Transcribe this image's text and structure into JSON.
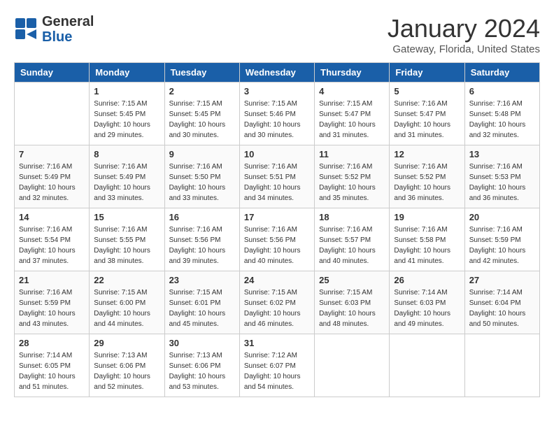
{
  "header": {
    "logo_general": "General",
    "logo_blue": "Blue",
    "title": "January 2024",
    "subtitle": "Gateway, Florida, United States"
  },
  "weekdays": [
    "Sunday",
    "Monday",
    "Tuesday",
    "Wednesday",
    "Thursday",
    "Friday",
    "Saturday"
  ],
  "weeks": [
    [
      {
        "day": "",
        "info": ""
      },
      {
        "day": "1",
        "info": "Sunrise: 7:15 AM\nSunset: 5:45 PM\nDaylight: 10 hours\nand 29 minutes."
      },
      {
        "day": "2",
        "info": "Sunrise: 7:15 AM\nSunset: 5:45 PM\nDaylight: 10 hours\nand 30 minutes."
      },
      {
        "day": "3",
        "info": "Sunrise: 7:15 AM\nSunset: 5:46 PM\nDaylight: 10 hours\nand 30 minutes."
      },
      {
        "day": "4",
        "info": "Sunrise: 7:15 AM\nSunset: 5:47 PM\nDaylight: 10 hours\nand 31 minutes."
      },
      {
        "day": "5",
        "info": "Sunrise: 7:16 AM\nSunset: 5:47 PM\nDaylight: 10 hours\nand 31 minutes."
      },
      {
        "day": "6",
        "info": "Sunrise: 7:16 AM\nSunset: 5:48 PM\nDaylight: 10 hours\nand 32 minutes."
      }
    ],
    [
      {
        "day": "7",
        "info": "Sunrise: 7:16 AM\nSunset: 5:49 PM\nDaylight: 10 hours\nand 32 minutes."
      },
      {
        "day": "8",
        "info": "Sunrise: 7:16 AM\nSunset: 5:49 PM\nDaylight: 10 hours\nand 33 minutes."
      },
      {
        "day": "9",
        "info": "Sunrise: 7:16 AM\nSunset: 5:50 PM\nDaylight: 10 hours\nand 33 minutes."
      },
      {
        "day": "10",
        "info": "Sunrise: 7:16 AM\nSunset: 5:51 PM\nDaylight: 10 hours\nand 34 minutes."
      },
      {
        "day": "11",
        "info": "Sunrise: 7:16 AM\nSunset: 5:52 PM\nDaylight: 10 hours\nand 35 minutes."
      },
      {
        "day": "12",
        "info": "Sunrise: 7:16 AM\nSunset: 5:52 PM\nDaylight: 10 hours\nand 36 minutes."
      },
      {
        "day": "13",
        "info": "Sunrise: 7:16 AM\nSunset: 5:53 PM\nDaylight: 10 hours\nand 36 minutes."
      }
    ],
    [
      {
        "day": "14",
        "info": "Sunrise: 7:16 AM\nSunset: 5:54 PM\nDaylight: 10 hours\nand 37 minutes."
      },
      {
        "day": "15",
        "info": "Sunrise: 7:16 AM\nSunset: 5:55 PM\nDaylight: 10 hours\nand 38 minutes."
      },
      {
        "day": "16",
        "info": "Sunrise: 7:16 AM\nSunset: 5:56 PM\nDaylight: 10 hours\nand 39 minutes."
      },
      {
        "day": "17",
        "info": "Sunrise: 7:16 AM\nSunset: 5:56 PM\nDaylight: 10 hours\nand 40 minutes."
      },
      {
        "day": "18",
        "info": "Sunrise: 7:16 AM\nSunset: 5:57 PM\nDaylight: 10 hours\nand 40 minutes."
      },
      {
        "day": "19",
        "info": "Sunrise: 7:16 AM\nSunset: 5:58 PM\nDaylight: 10 hours\nand 41 minutes."
      },
      {
        "day": "20",
        "info": "Sunrise: 7:16 AM\nSunset: 5:59 PM\nDaylight: 10 hours\nand 42 minutes."
      }
    ],
    [
      {
        "day": "21",
        "info": "Sunrise: 7:16 AM\nSunset: 5:59 PM\nDaylight: 10 hours\nand 43 minutes."
      },
      {
        "day": "22",
        "info": "Sunrise: 7:15 AM\nSunset: 6:00 PM\nDaylight: 10 hours\nand 44 minutes."
      },
      {
        "day": "23",
        "info": "Sunrise: 7:15 AM\nSunset: 6:01 PM\nDaylight: 10 hours\nand 45 minutes."
      },
      {
        "day": "24",
        "info": "Sunrise: 7:15 AM\nSunset: 6:02 PM\nDaylight: 10 hours\nand 46 minutes."
      },
      {
        "day": "25",
        "info": "Sunrise: 7:15 AM\nSunset: 6:03 PM\nDaylight: 10 hours\nand 48 minutes."
      },
      {
        "day": "26",
        "info": "Sunrise: 7:14 AM\nSunset: 6:03 PM\nDaylight: 10 hours\nand 49 minutes."
      },
      {
        "day": "27",
        "info": "Sunrise: 7:14 AM\nSunset: 6:04 PM\nDaylight: 10 hours\nand 50 minutes."
      }
    ],
    [
      {
        "day": "28",
        "info": "Sunrise: 7:14 AM\nSunset: 6:05 PM\nDaylight: 10 hours\nand 51 minutes."
      },
      {
        "day": "29",
        "info": "Sunrise: 7:13 AM\nSunset: 6:06 PM\nDaylight: 10 hours\nand 52 minutes."
      },
      {
        "day": "30",
        "info": "Sunrise: 7:13 AM\nSunset: 6:06 PM\nDaylight: 10 hours\nand 53 minutes."
      },
      {
        "day": "31",
        "info": "Sunrise: 7:12 AM\nSunset: 6:07 PM\nDaylight: 10 hours\nand 54 minutes."
      },
      {
        "day": "",
        "info": ""
      },
      {
        "day": "",
        "info": ""
      },
      {
        "day": "",
        "info": ""
      }
    ]
  ]
}
